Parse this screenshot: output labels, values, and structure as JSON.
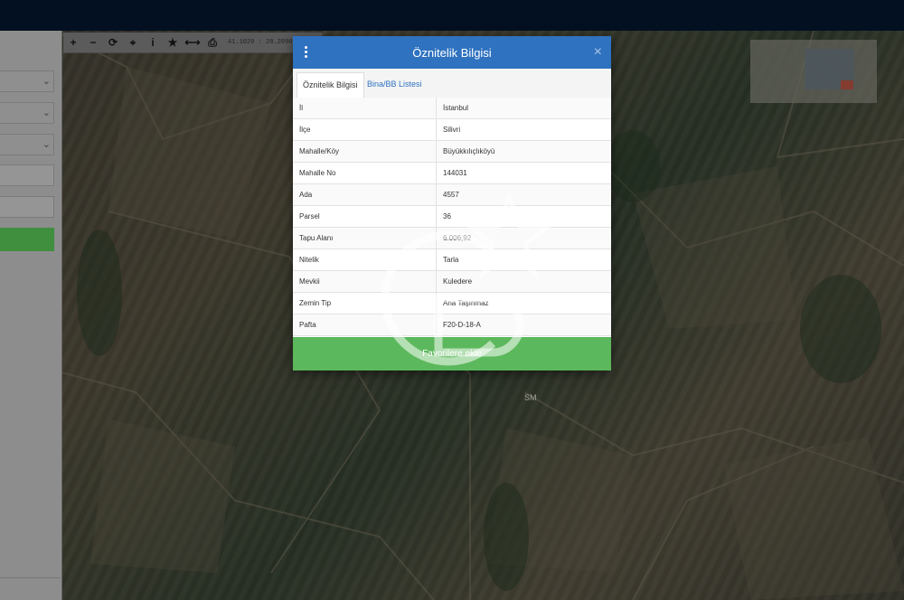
{
  "toolbar": {
    "buttons": [
      {
        "name": "zoom-in-button",
        "icon": "plus-icon",
        "glyph": "+"
      },
      {
        "name": "zoom-out-button",
        "icon": "minus-icon",
        "glyph": "−"
      },
      {
        "name": "refresh-button",
        "icon": "refresh-icon",
        "glyph": "⟳"
      },
      {
        "name": "locate-button",
        "icon": "crosshair-icon",
        "glyph": "⌖"
      },
      {
        "name": "info-button",
        "icon": "info-icon",
        "glyph": "i"
      },
      {
        "name": "favorite-button",
        "icon": "star-icon",
        "glyph": "★"
      },
      {
        "name": "measure-button",
        "icon": "measure-icon",
        "glyph": "⟷"
      },
      {
        "name": "print-button",
        "icon": "print-icon",
        "glyph": "⎙"
      }
    ],
    "coordinates": "41.1020 : 28.2090"
  },
  "modal": {
    "title": "Öznitelik Bilgisi",
    "tabs": [
      "Öznitelik Bilgisi",
      "Bina/BB Listesi"
    ],
    "rows": [
      {
        "key": "İl",
        "value": "İstanbul"
      },
      {
        "key": "İlçe",
        "value": "Silivri"
      },
      {
        "key": "Mahalle/Köy",
        "value": "Büyükkılıçlıköyü"
      },
      {
        "key": "Mahalle No",
        "value": "144031"
      },
      {
        "key": "Ada",
        "value": "4557"
      },
      {
        "key": "Parsel",
        "value": "36"
      },
      {
        "key": "Tapu Alanı",
        "value": "6.006,92"
      },
      {
        "key": "Nitelik",
        "value": "Tarla"
      },
      {
        "key": "Mevkii",
        "value": "Kuledere"
      },
      {
        "key": "Zemin Tip",
        "value": "Ana Taşınmaz"
      },
      {
        "key": "Pafta",
        "value": "F20-D-18-A"
      }
    ],
    "favorite_button": "Favorilere ekle"
  },
  "watermark": {
    "text": "SM"
  },
  "colors": {
    "header": "#2f72c0",
    "favorite": "#5cb85c",
    "topbar": "#021021"
  }
}
